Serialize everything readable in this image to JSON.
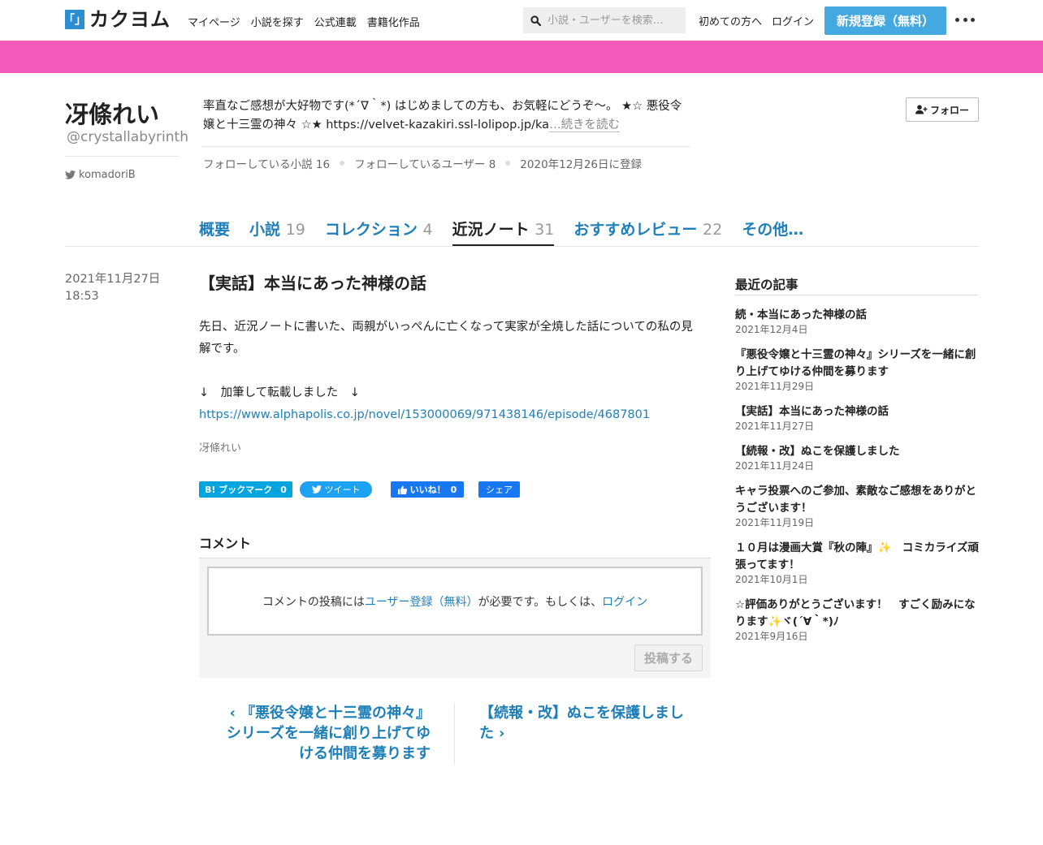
{
  "header": {
    "logo_mark": "「」",
    "logo_text": "カクヨム",
    "nav": [
      "マイページ",
      "小説を探す",
      "公式連載",
      "書籍化作品"
    ],
    "search_placeholder": "小説・ユーザーを検索…",
    "first_time": "初めての方へ",
    "login": "ログイン",
    "signup": "新規登録（無料）"
  },
  "colors": {
    "banner": "#f559b9",
    "accent": "#1e7fb8",
    "signup": "#44a9e0"
  },
  "profile": {
    "name": "冴條れい",
    "handle": "@crystallabyrinth",
    "twitter": "komadoriB",
    "bio": "率直なご感想が大好物です(*´∇｀*) はじめましての方も、お気軽にどうぞ～。 ★☆ 悪役令嬢と十三霊の神々 ☆★ https://velvet-kazakiri.ssl-lolipop.jp/ka",
    "read_more": "…続きを読む",
    "follow": "フォロー",
    "stats": {
      "following_novels": "フォローしている小説 16",
      "following_users": "フォローしているユーザー 8",
      "registered": "2020年12月26日に登録"
    }
  },
  "tabs": [
    {
      "label": "概要",
      "count": ""
    },
    {
      "label": "小説",
      "count": "19"
    },
    {
      "label": "コレクション",
      "count": "4"
    },
    {
      "label": "近況ノート",
      "count": "31"
    },
    {
      "label": "おすすめレビュー",
      "count": "22"
    },
    {
      "label": "その他…",
      "count": ""
    }
  ],
  "article": {
    "date": "2021年11月27日",
    "time": "18:53",
    "title": "【実話】本当にあった神様の話",
    "para1": "先日、近況ノートに書いた、両親がいっぺんに亡くなって実家が全焼した話についての私の見解です。",
    "para2": "↓　加筆して転載しました　↓",
    "link": "https://www.alphapolis.co.jp/novel/153000069/971438146/episode/4687801",
    "author": "冴條れい"
  },
  "share": {
    "hatena": "B! ブックマーク",
    "hatena_count": "0",
    "tweet": "ツイート",
    "like": "いいね！",
    "like_count": "0",
    "fb_share": "シェア"
  },
  "comments": {
    "title": "コメント",
    "prefix": "コメントの投稿には",
    "signup_link": "ユーザー登録（無料）",
    "middle": "が必要です。もしくは、",
    "login_link": "ログイン",
    "post": "投稿する"
  },
  "pager": {
    "prev": "『悪役令嬢と十三霊の神々』シリーズを一緒に創り上げてゆける仲間を募ります",
    "next": "【続報・改】ぬこを保護しました"
  },
  "sidebar": {
    "title": "最近の記事",
    "items": [
      {
        "title": "続・本当にあった神様の話",
        "date": "2021年12月4日"
      },
      {
        "title": "『悪役令嬢と十三霊の神々』シリーズを一緒に創り上げてゆける仲間を募ります",
        "date": "2021年11月29日"
      },
      {
        "title": "【実話】本当にあった神様の話",
        "date": "2021年11月27日"
      },
      {
        "title": "【続報・改】ぬこを保護しました",
        "date": "2021年11月24日"
      },
      {
        "title": "キャラ投票へのご参加、素敵なご感想をありがとうございます！",
        "date": "2021年11月19日"
      },
      {
        "title": "１０月は漫画大賞『秋の陣』✨　コミカライズ頑張ってます！",
        "date": "2021年10月1日"
      },
      {
        "title": "☆評価ありがとうございます！　すごく励みになります✨ヾ(´∀｀*)ﾉ",
        "date": "2021年9月16日"
      }
    ]
  }
}
